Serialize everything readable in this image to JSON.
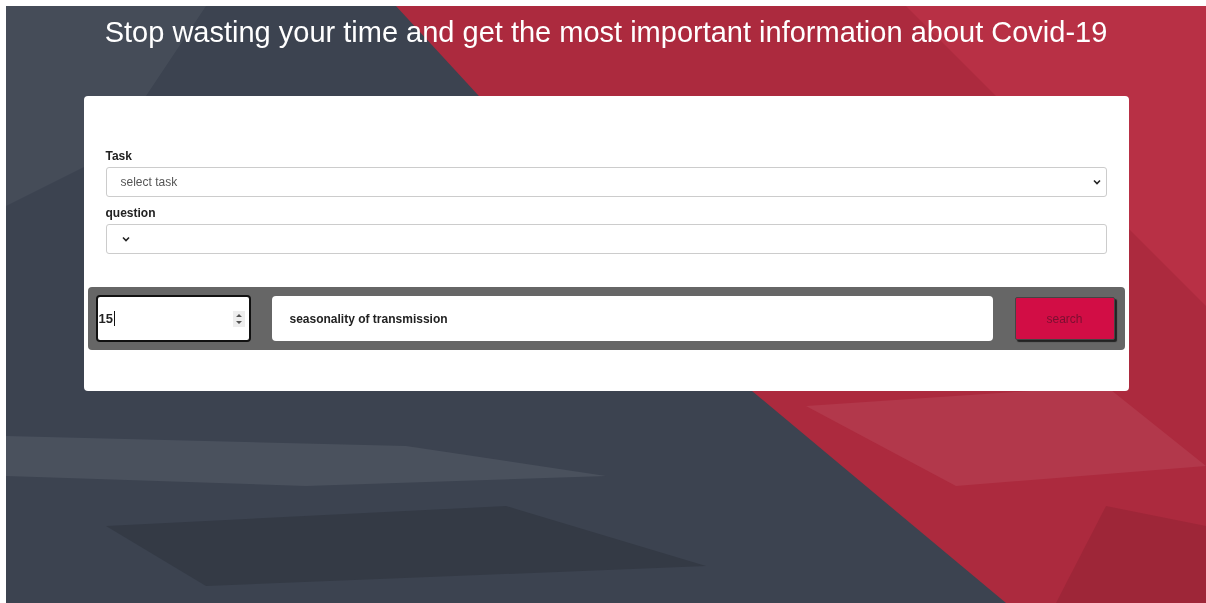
{
  "header": {
    "title": "Stop wasting your time and get the most important information about Covid-19"
  },
  "form": {
    "fields": [
      {
        "label": "Task",
        "kind": "select",
        "value": "select task"
      },
      {
        "label": "question",
        "kind": "select"
      }
    ]
  },
  "search_bar": {
    "count": "15",
    "query": "seasonality of transmission",
    "button": "search"
  }
}
